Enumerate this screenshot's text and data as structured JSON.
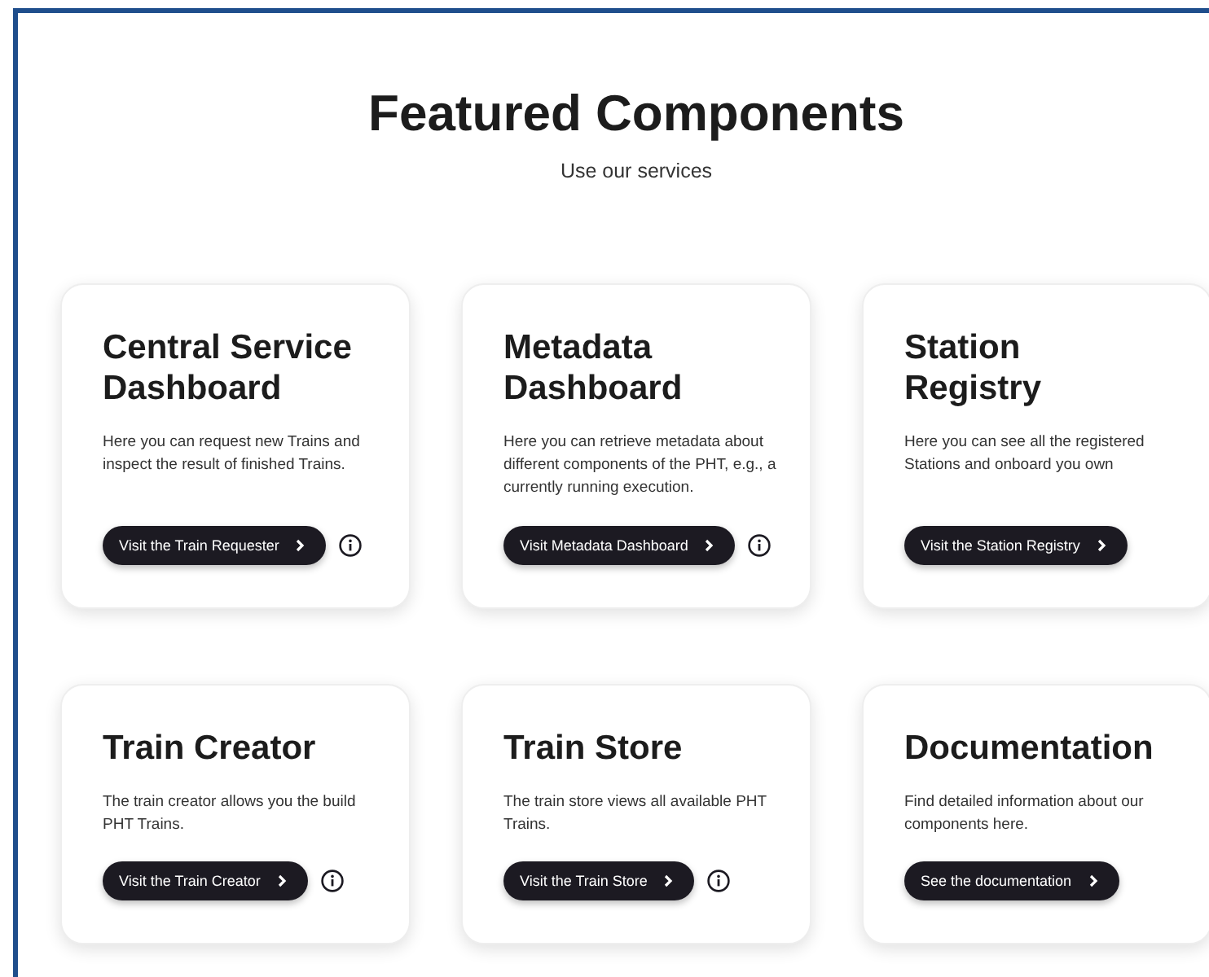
{
  "heading": "Featured Components",
  "subheading": "Use our services",
  "cards": [
    {
      "title": "Central Service Dashboard",
      "description": "Here you can request new Trains and inspect the result of finished Trains.",
      "button": "Visit the Train Requester",
      "has_info": true
    },
    {
      "title": "Metadata Dashboard",
      "description": "Here you can retrieve metadata about different components of the PHT, e.g., a currently running execution.",
      "button": "Visit Metadata Dashboard",
      "has_info": true
    },
    {
      "title": "Station Registry",
      "description": "Here you can see all the registered Stations and onboard you own",
      "button": "Visit the Station Registry",
      "has_info": false
    },
    {
      "title": "Train Creator",
      "description": "The train creator allows you the build PHT Trains.",
      "button": "Visit the Train Creator",
      "has_info": true
    },
    {
      "title": "Train Store",
      "description": "The train store views all available PHT Trains.",
      "button": "Visit the Train Store",
      "has_info": true
    },
    {
      "title": "Documentation",
      "description": "Find detailed information about our components here.",
      "button": "See the documentation",
      "has_info": false
    }
  ]
}
